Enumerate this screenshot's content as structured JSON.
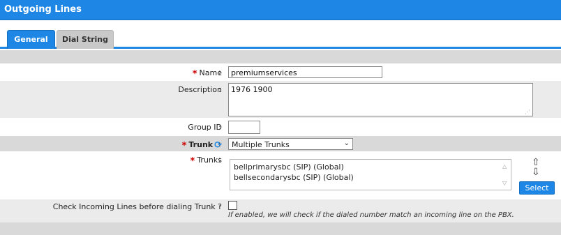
{
  "window": {
    "title": "Outgoing Lines"
  },
  "tabs": [
    {
      "label": "General",
      "active": true
    },
    {
      "label": "Dial String",
      "active": false
    }
  ],
  "form": {
    "name": {
      "label": "Name",
      "colon": ":",
      "value": "premiumservices",
      "required": true
    },
    "description": {
      "label": "Description",
      "colon": ":",
      "value": "1976 1900"
    },
    "group_id": {
      "label": "Group ID",
      "colon": ":",
      "value": ""
    },
    "trunk": {
      "label": "Trunk",
      "colon": ":",
      "selected": "Multiple Trunks",
      "required": true,
      "icon": "refresh-icon"
    },
    "trunks": {
      "label": "Trunks",
      "colon": ":",
      "required": true,
      "items": [
        "bellprimarysbc (SIP) (Global)",
        "bellsecondarysbc (SIP) (Global)"
      ],
      "select_button": "Select"
    },
    "check_incoming": {
      "label": "Check Incoming Lines before dialing Trunk ?",
      "colon": ":",
      "checked": false,
      "hint": "If enabled, we will check if the dialed number match an incoming line on the PBX."
    }
  },
  "colors": {
    "accent": "#1e87e6",
    "required": "#cc0000"
  }
}
